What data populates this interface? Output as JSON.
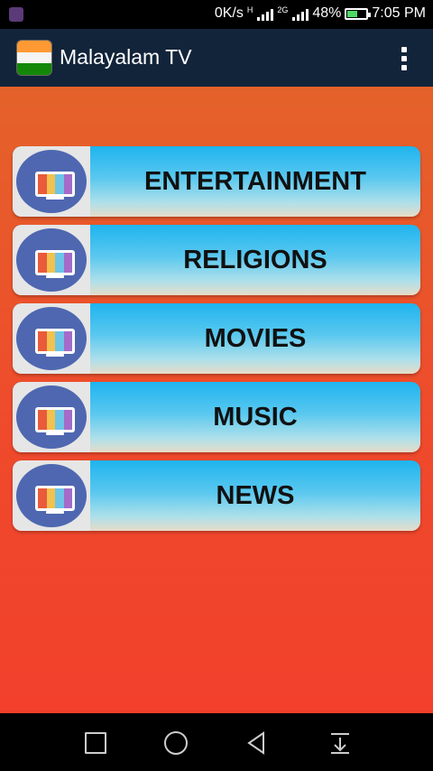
{
  "status": {
    "speed": "0K/s",
    "net1": "H",
    "net2": "2G",
    "battery": "48%",
    "time": "7:05 PM"
  },
  "app": {
    "title": "Malayalam TV"
  },
  "categories": [
    {
      "label": "ENTERTAINMENT"
    },
    {
      "label": "RELIGIONS"
    },
    {
      "label": "MOVIES"
    },
    {
      "label": "MUSIC"
    },
    {
      "label": "NEWS"
    }
  ],
  "icons": {
    "category": "tv-icon",
    "overflow": "more-vert-icon",
    "logo": "india-flag-icon",
    "nav": [
      "recent-apps-icon",
      "home-icon",
      "back-icon",
      "notification-down-icon"
    ]
  },
  "colors": {
    "toolbar": "#12243a",
    "background_top": "#e4622a",
    "background_bottom": "#f2402c",
    "button_top": "#1fb4ef",
    "icon_circle": "#4e67b0"
  }
}
